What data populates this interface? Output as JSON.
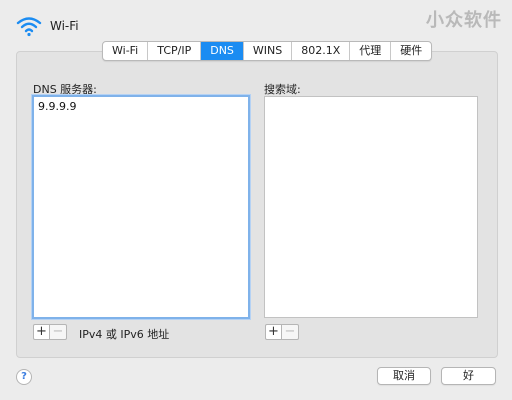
{
  "header": {
    "title": "Wi-Fi",
    "icon": "wifi-icon",
    "watermark": "小众软件"
  },
  "tabs": [
    {
      "label": "Wi-Fi",
      "active": false
    },
    {
      "label": "TCP/IP",
      "active": false
    },
    {
      "label": "DNS",
      "active": true
    },
    {
      "label": "WINS",
      "active": false
    },
    {
      "label": "802.1X",
      "active": false
    },
    {
      "label": "代理",
      "active": false
    },
    {
      "label": "硬件",
      "active": false
    }
  ],
  "dns": {
    "servers_label": "DNS 服务器:",
    "servers": [
      "9.9.9.9"
    ],
    "search_label": "搜索域:",
    "search_domains": [],
    "ip_note": "IPv4 或 IPv6 地址"
  },
  "buttons": {
    "add": "+",
    "remove": "−",
    "help": "?",
    "cancel": "取消",
    "ok": "好"
  },
  "colors": {
    "accent": "#1b8cf2",
    "focus_ring": "#7fb2ea"
  }
}
